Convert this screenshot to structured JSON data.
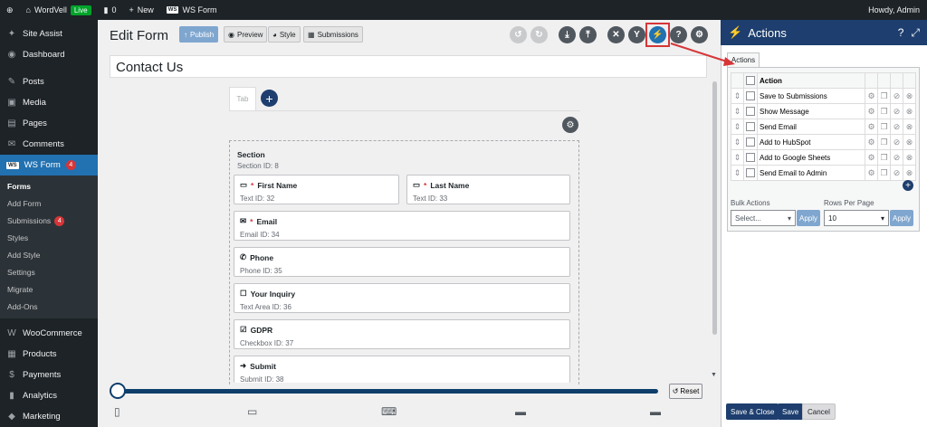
{
  "adminbar": {
    "site": "WordVell",
    "live": "Live",
    "comments": "0",
    "new": "New",
    "plugin": "WS Form",
    "howdy": "Howdy, Admin"
  },
  "sidebar": {
    "top": [
      {
        "icon": "✦",
        "label": "Site Assist"
      },
      {
        "icon": "◉",
        "label": "Dashboard"
      },
      {
        "icon": "✎",
        "label": "Posts"
      },
      {
        "icon": "▣",
        "label": "Media"
      },
      {
        "icon": "▤",
        "label": "Pages"
      },
      {
        "icon": "✉",
        "label": "Comments"
      }
    ],
    "wsform": {
      "label": "WS Form",
      "badge": "4"
    },
    "submenu": [
      {
        "label": "Forms"
      },
      {
        "label": "Add Form"
      },
      {
        "label": "Submissions",
        "badge": "4"
      },
      {
        "label": "Styles"
      },
      {
        "label": "Add Style"
      },
      {
        "label": "Settings"
      },
      {
        "label": "Migrate"
      },
      {
        "label": "Add-Ons"
      }
    ],
    "bottom": [
      {
        "icon": "W",
        "label": "WooCommerce"
      },
      {
        "icon": "▦",
        "label": "Products"
      },
      {
        "icon": "$",
        "label": "Payments"
      },
      {
        "icon": "▮",
        "label": "Analytics"
      },
      {
        "icon": "◆",
        "label": "Marketing"
      }
    ]
  },
  "editor": {
    "title": "Edit Form",
    "buttons": {
      "publish": "Publish",
      "preview": "Preview",
      "style": "Style",
      "submissions": "Submissions"
    },
    "form_name": "Contact Us",
    "tab_label": "Tab",
    "section": {
      "title": "Section",
      "id": "Section  ID: 8"
    },
    "fields": [
      {
        "label": "First Name",
        "required": true,
        "meta": "Text  ID: 32",
        "icon": "▭"
      },
      {
        "label": "Last Name",
        "required": true,
        "meta": "Text  ID: 33",
        "icon": "▭"
      },
      {
        "label": "Email",
        "required": true,
        "meta": "Email  ID: 34",
        "icon": "✉"
      },
      {
        "label": "Phone",
        "required": false,
        "meta": "Phone  ID: 35",
        "icon": "✆"
      },
      {
        "label": "Your Inquiry",
        "required": false,
        "meta": "Text Area  ID: 36",
        "icon": "☐"
      },
      {
        "label": "GDPR",
        "required": false,
        "meta": "Checkbox  ID: 37",
        "icon": "☑"
      },
      {
        "label": "Submit",
        "required": false,
        "meta": "Submit  ID: 38",
        "icon": "➜"
      }
    ],
    "reset": "Reset"
  },
  "panel": {
    "title": "Actions",
    "tab": "Actions",
    "column": "Action",
    "actions": [
      "Save to Submissions",
      "Show Message",
      "Send Email",
      "Add to HubSpot",
      "Add to Google Sheets",
      "Send Email to Admin"
    ],
    "bulk_label": "Bulk Actions",
    "bulk_value": "Select...",
    "rows_label": "Rows Per Page",
    "rows_value": "10",
    "apply": "Apply",
    "save_close": "Save & Close",
    "save": "Save",
    "cancel": "Cancel"
  },
  "colors": {
    "accent": "#1d3e6e",
    "highlight": "#d63638",
    "wp_active": "#2271b1"
  }
}
